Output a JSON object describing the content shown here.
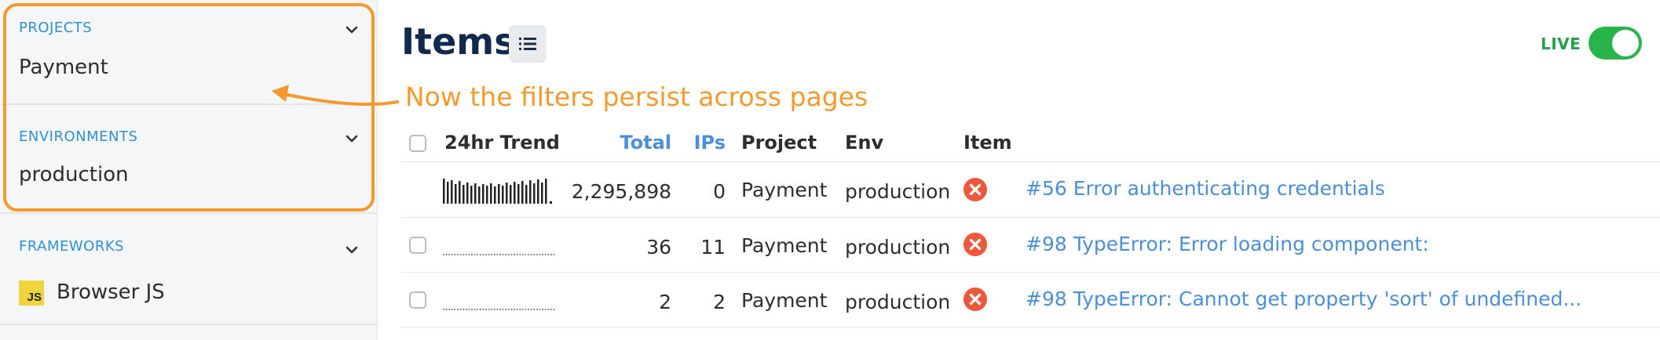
{
  "sidebar": {
    "sections": [
      {
        "title": "PROJECTS",
        "value": "Payment"
      },
      {
        "title": "ENVIRONMENTS",
        "value": "production"
      },
      {
        "title": "FRAMEWORKS",
        "value": "Browser JS",
        "badge": "JS"
      }
    ]
  },
  "header": {
    "title": "Items",
    "list_icon": "list-icon",
    "live_label": "LIVE",
    "live_on": true
  },
  "callout": {
    "text": "Now the filters persist across pages",
    "color": "#f39a2b"
  },
  "table": {
    "columns": {
      "trend": "24hr Trend",
      "total": "Total",
      "ips": "IPs",
      "project": "Project",
      "env": "Env",
      "item": "Item"
    },
    "rows": [
      {
        "total": "2,295,898",
        "ips": "0",
        "project": "Payment",
        "env": "production",
        "level": "error",
        "item": "#56 Error authenticating credentials"
      },
      {
        "total": "36",
        "ips": "11",
        "project": "Payment",
        "env": "production",
        "level": "error",
        "item": "#98 TypeError: Error loading component:"
      },
      {
        "total": "2",
        "ips": "2",
        "project": "Payment",
        "env": "production",
        "level": "error",
        "item": "#98 TypeError: Cannot get property 'sort' of undefined..."
      }
    ]
  },
  "colors": {
    "accent": "#f39a2b",
    "link": "#4a8fd9",
    "section_title": "#2f8fd6",
    "live": "#28b34b",
    "error": "#f0563a",
    "title": "#10294d"
  }
}
